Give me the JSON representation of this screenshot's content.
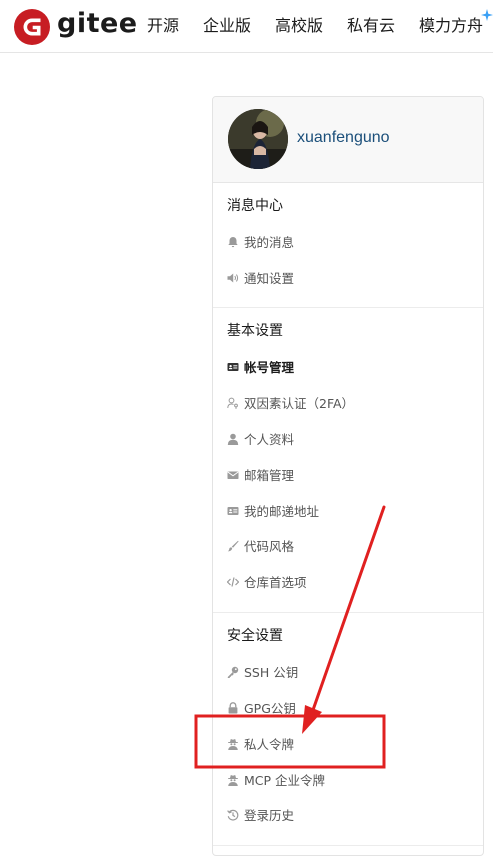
{
  "nav": {
    "brand": "gitee",
    "items": [
      "开源",
      "企业版",
      "高校版",
      "私有云",
      "模力方舟"
    ]
  },
  "profile": {
    "username": "xuanfenguno"
  },
  "sections": [
    {
      "title": "消息中心",
      "items": [
        {
          "label": "我的消息",
          "icon": "bell-icon"
        },
        {
          "label": "通知设置",
          "icon": "speaker-icon"
        }
      ]
    },
    {
      "title": "基本设置",
      "items": [
        {
          "label": "帐号管理",
          "icon": "id-card-icon",
          "active": true
        },
        {
          "label": "双因素认证（2FA）",
          "icon": "user-key-icon"
        },
        {
          "label": "个人资料",
          "icon": "user-icon"
        },
        {
          "label": "邮箱管理",
          "icon": "envelope-icon"
        },
        {
          "label": "我的邮递地址",
          "icon": "address-card-icon"
        },
        {
          "label": "代码风格",
          "icon": "brush-icon"
        },
        {
          "label": "仓库首选项",
          "icon": "code-icon"
        }
      ]
    },
    {
      "title": "安全设置",
      "items": [
        {
          "label": "SSH 公钥",
          "icon": "key-icon"
        },
        {
          "label": "GPG公钥",
          "icon": "lock-icon"
        },
        {
          "label": "私人令牌",
          "icon": "user-secret-icon",
          "highlighted": true
        },
        {
          "label": "MCP 企业令牌",
          "icon": "user-secret-icon"
        },
        {
          "label": "登录历史",
          "icon": "history-icon"
        }
      ]
    }
  ],
  "colors": {
    "brand": "#c71d23",
    "annotation": "#e02020",
    "username": "#1b4f7a"
  }
}
